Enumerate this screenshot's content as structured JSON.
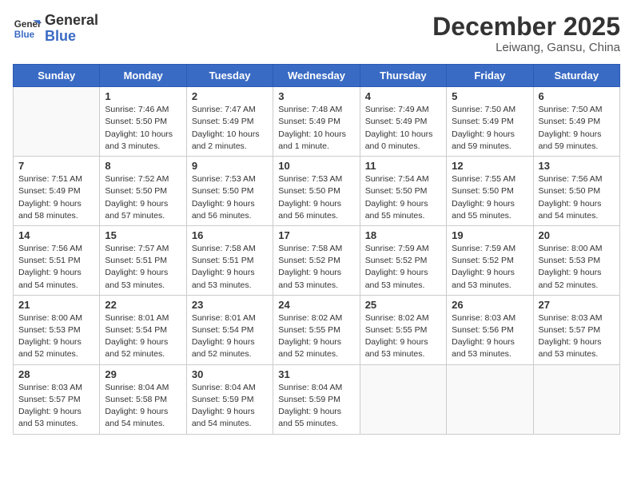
{
  "logo": {
    "line1": "General",
    "line2": "Blue"
  },
  "title": "December 2025",
  "location": "Leiwang, Gansu, China",
  "weekdays": [
    "Sunday",
    "Monday",
    "Tuesday",
    "Wednesday",
    "Thursday",
    "Friday",
    "Saturday"
  ],
  "weeks": [
    [
      {
        "day": "",
        "info": ""
      },
      {
        "day": "1",
        "info": "Sunrise: 7:46 AM\nSunset: 5:50 PM\nDaylight: 10 hours\nand 3 minutes."
      },
      {
        "day": "2",
        "info": "Sunrise: 7:47 AM\nSunset: 5:49 PM\nDaylight: 10 hours\nand 2 minutes."
      },
      {
        "day": "3",
        "info": "Sunrise: 7:48 AM\nSunset: 5:49 PM\nDaylight: 10 hours\nand 1 minute."
      },
      {
        "day": "4",
        "info": "Sunrise: 7:49 AM\nSunset: 5:49 PM\nDaylight: 10 hours\nand 0 minutes."
      },
      {
        "day": "5",
        "info": "Sunrise: 7:50 AM\nSunset: 5:49 PM\nDaylight: 9 hours\nand 59 minutes."
      },
      {
        "day": "6",
        "info": "Sunrise: 7:50 AM\nSunset: 5:49 PM\nDaylight: 9 hours\nand 59 minutes."
      }
    ],
    [
      {
        "day": "7",
        "info": "Sunrise: 7:51 AM\nSunset: 5:49 PM\nDaylight: 9 hours\nand 58 minutes."
      },
      {
        "day": "8",
        "info": "Sunrise: 7:52 AM\nSunset: 5:50 PM\nDaylight: 9 hours\nand 57 minutes."
      },
      {
        "day": "9",
        "info": "Sunrise: 7:53 AM\nSunset: 5:50 PM\nDaylight: 9 hours\nand 56 minutes."
      },
      {
        "day": "10",
        "info": "Sunrise: 7:53 AM\nSunset: 5:50 PM\nDaylight: 9 hours\nand 56 minutes."
      },
      {
        "day": "11",
        "info": "Sunrise: 7:54 AM\nSunset: 5:50 PM\nDaylight: 9 hours\nand 55 minutes."
      },
      {
        "day": "12",
        "info": "Sunrise: 7:55 AM\nSunset: 5:50 PM\nDaylight: 9 hours\nand 55 minutes."
      },
      {
        "day": "13",
        "info": "Sunrise: 7:56 AM\nSunset: 5:50 PM\nDaylight: 9 hours\nand 54 minutes."
      }
    ],
    [
      {
        "day": "14",
        "info": "Sunrise: 7:56 AM\nSunset: 5:51 PM\nDaylight: 9 hours\nand 54 minutes."
      },
      {
        "day": "15",
        "info": "Sunrise: 7:57 AM\nSunset: 5:51 PM\nDaylight: 9 hours\nand 53 minutes."
      },
      {
        "day": "16",
        "info": "Sunrise: 7:58 AM\nSunset: 5:51 PM\nDaylight: 9 hours\nand 53 minutes."
      },
      {
        "day": "17",
        "info": "Sunrise: 7:58 AM\nSunset: 5:52 PM\nDaylight: 9 hours\nand 53 minutes."
      },
      {
        "day": "18",
        "info": "Sunrise: 7:59 AM\nSunset: 5:52 PM\nDaylight: 9 hours\nand 53 minutes."
      },
      {
        "day": "19",
        "info": "Sunrise: 7:59 AM\nSunset: 5:52 PM\nDaylight: 9 hours\nand 53 minutes."
      },
      {
        "day": "20",
        "info": "Sunrise: 8:00 AM\nSunset: 5:53 PM\nDaylight: 9 hours\nand 52 minutes."
      }
    ],
    [
      {
        "day": "21",
        "info": "Sunrise: 8:00 AM\nSunset: 5:53 PM\nDaylight: 9 hours\nand 52 minutes."
      },
      {
        "day": "22",
        "info": "Sunrise: 8:01 AM\nSunset: 5:54 PM\nDaylight: 9 hours\nand 52 minutes."
      },
      {
        "day": "23",
        "info": "Sunrise: 8:01 AM\nSunset: 5:54 PM\nDaylight: 9 hours\nand 52 minutes."
      },
      {
        "day": "24",
        "info": "Sunrise: 8:02 AM\nSunset: 5:55 PM\nDaylight: 9 hours\nand 52 minutes."
      },
      {
        "day": "25",
        "info": "Sunrise: 8:02 AM\nSunset: 5:55 PM\nDaylight: 9 hours\nand 53 minutes."
      },
      {
        "day": "26",
        "info": "Sunrise: 8:03 AM\nSunset: 5:56 PM\nDaylight: 9 hours\nand 53 minutes."
      },
      {
        "day": "27",
        "info": "Sunrise: 8:03 AM\nSunset: 5:57 PM\nDaylight: 9 hours\nand 53 minutes."
      }
    ],
    [
      {
        "day": "28",
        "info": "Sunrise: 8:03 AM\nSunset: 5:57 PM\nDaylight: 9 hours\nand 53 minutes."
      },
      {
        "day": "29",
        "info": "Sunrise: 8:04 AM\nSunset: 5:58 PM\nDaylight: 9 hours\nand 54 minutes."
      },
      {
        "day": "30",
        "info": "Sunrise: 8:04 AM\nSunset: 5:59 PM\nDaylight: 9 hours\nand 54 minutes."
      },
      {
        "day": "31",
        "info": "Sunrise: 8:04 AM\nSunset: 5:59 PM\nDaylight: 9 hours\nand 55 minutes."
      },
      {
        "day": "",
        "info": ""
      },
      {
        "day": "",
        "info": ""
      },
      {
        "day": "",
        "info": ""
      }
    ]
  ]
}
